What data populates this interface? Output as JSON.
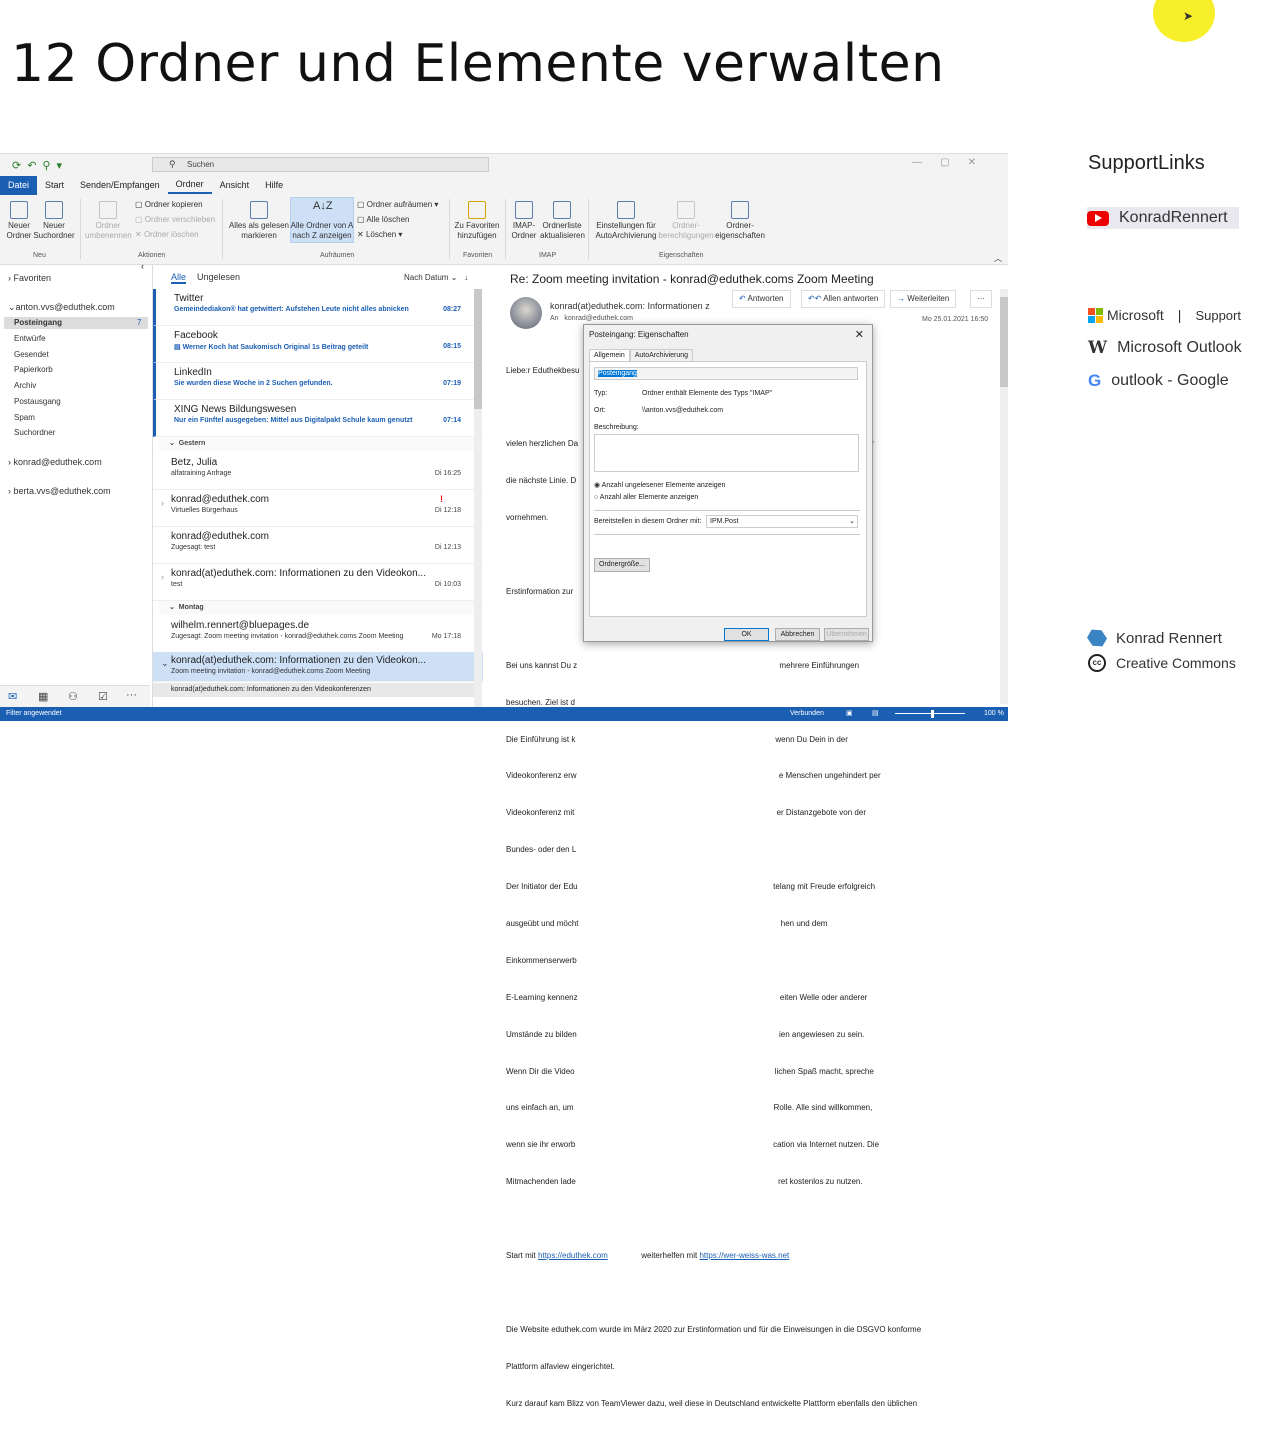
{
  "slide": {
    "title": "12 Ordner und Elemente verwalten"
  },
  "support": {
    "title": "SupportLinks",
    "youtube": "KonradRennert",
    "microsoft": "Microsoft",
    "ms_support": "Support",
    "wiki": "Microsoft Outlook",
    "google": "outlook - Google",
    "author": "Konrad Rennert",
    "license": "Creative Commons"
  },
  "outlook": {
    "search_placeholder": "Suchen",
    "menu": [
      "Datei",
      "Start",
      "Senden/Empfangen",
      "Ordner",
      "Ansicht",
      "Hilfe"
    ],
    "ribbon": {
      "neuer_ordner": "Neuer Ordner",
      "neuer_suchordner": "Neuer Suchordner",
      "ordner_umbenennen": "Ordner umbenennen",
      "ordner_kopieren": "Ordner kopieren",
      "ordner_verschieben": "Ordner verschieben",
      "ordner_loeschen": "Ordner löschen",
      "alles_gelesen": "Alles als gelesen markieren",
      "alle_ordner_az": "Alle Ordner von A nach Z anzeigen",
      "ordner_aufraeumen": "Ordner aufräumen",
      "alle_loeschen": "Alle löschen",
      "loeschen": "Löschen",
      "zu_favoriten": "Zu Favoriten hinzufügen",
      "imap_ordner": "IMAP-Ordner",
      "ordnerliste": "Ordnerliste aktualisieren",
      "einstellungen_auto": "Einstellungen für AutoArchivierung",
      "ordner_berechtigungen": "Ordner-berechtigungen",
      "ordner_eigenschaften": "Ordner-eigenschaften",
      "groups": [
        "Neu",
        "Aktionen",
        "Aufräumen",
        "Favoriten",
        "IMAP",
        "Eigenschaften"
      ]
    },
    "folders": {
      "favoriten": "Favoriten",
      "account1": "anton.vvs@eduthek.com",
      "items": [
        "Posteingang",
        "Entwürfe",
        "Gesendet",
        "Papierkorb",
        "Archiv",
        "Postausgang",
        "Spam",
        "Suchordner"
      ],
      "posteingang_count": "7",
      "account2": "konrad@eduthek.com",
      "account3": "berta.vvs@eduthek.com"
    },
    "list": {
      "tab_all": "Alle",
      "tab_unread": "Ungelesen",
      "sort": "Nach Datum",
      "group_yesterday": "Gestern",
      "group_monday": "Montag",
      "messages": [
        {
          "from": "Twitter",
          "subject": "Gemeindediakon® hat getwittert: Aufstehen Leute nicht alles abnicken",
          "time": "08:27"
        },
        {
          "from": "Facebook",
          "subject": "Werner Koch hat Saukomisch Original 1s Beitrag geteilt",
          "time": "08:15"
        },
        {
          "from": "LinkedIn",
          "subject": "Sie wurden diese Woche in 2 Suchen gefunden.",
          "time": "07:19"
        },
        {
          "from": "XING News Bildungswesen",
          "subject": "Nur ein Fünftel ausgegeben: Mittel aus Digitalpakt Schule kaum genutzt",
          "time": "07:14"
        },
        {
          "from": "Betz, Julia",
          "subject": "alfatraining Anfrage",
          "time": "Di 16:25"
        },
        {
          "from": "konrad@eduthek.com",
          "subject": "Virtuelles Bürgerhaus",
          "time": "Di 12:18"
        },
        {
          "from": "konrad@eduthek.com",
          "subject": "Zugesagt: test",
          "time": "Di 12:13"
        },
        {
          "from": "konrad(at)eduthek.com: Informationen zu den Videokon...",
          "subject": "test",
          "time": "Di 10:03"
        },
        {
          "from": "wilhelm.rennert@bluepages.de",
          "subject": "Zugesagt: Zoom meeting invitation - konrad@eduthek.coms Zoom Meeting",
          "time": "Mo 17:18"
        },
        {
          "from": "konrad(at)eduthek.com: Informationen zu den Videokon...",
          "subject": "Zoom meeting invitation - konrad@eduthek.coms Zoom Meeting",
          "time": ""
        },
        {
          "from": "",
          "subject": "konrad(at)eduthek.com: Informationen zu den Videokonferenzen",
          "time": ""
        }
      ]
    },
    "reading": {
      "subject": "Re:  Zoom meeting invitation - konrad@eduthek.coms Zoom Meeting",
      "sender": "konrad(at)eduthek.com: Informationen z",
      "to_label": "An",
      "to": "konrad@eduthek.com",
      "date": "Mo 25.01.2021 16:50",
      "reply": "Antworten",
      "reply_all": "Allen antworten",
      "forward": "Weiterleiten",
      "more": "···",
      "body": [
        "Liebe:r Eduthekbesu",
        "",
        "vielen herzlichen Da                                                                                           st, blättere weiter bis unter",
        "die nächste Linie. D                                                                                          wir zurzeit Einweisungen",
        "vornehmen.",
        "",
        "Erstinformation zur",
        "",
        "Bei uns kannst Du z                                                                                           mehrere Einführungen",
        "besuchen. Ziel ist d",
        "Die Einführung ist k                                                                                          wenn Du Dein in der",
        "Videokonferenz erw                                                                                           e Menschen ungehindert per",
        "Videokonferenz mit                                                                                           er Distanzgebote von der",
        "Bundes- oder den L",
        "Der Initiator der Edu                                                                                        telang mit Freude erfolgreich",
        "ausgeübt und möcht                                                                                           hen und dem",
        "Einkommenserwerb",
        "E-Learning kennenz                                                                                           eiten Welle oder anderer",
        "Umstände zu bilden                                                                                           ien angewiesen zu sein.",
        "Wenn Dir die Video                                                                                          lichen Spaß macht, spreche",
        "uns einfach an, um                                                                                          Rolle. Alle sind willkommen,",
        "wenn sie ihr erworb                                                                                         cation via Internet nutzen. Die",
        "Mitmachenden lade                                                                                           ret kostenlos zu nutzen."
      ],
      "start_label": "Start mit",
      "start_link": "https://eduthek.com",
      "start_rest": "weiterhelfen mit",
      "start_link2": "https://wer-weiss-was.net",
      "body2": "Die Website eduthek.com wurde im März 2020 zur Erstinformation und für die Einweisungen in die DSGVO konforme",
      "body3": "Plattform alfaview eingerichtet.",
      "body4": "Kurz darauf kam Blizz von TeamViewer dazu, weil diese in Deutschland entwickelte Plattform ebenfalls den üblichen"
    },
    "dialog": {
      "title": "Posteingang: Eigenschaften",
      "tab1": "Allgemein",
      "tab2": "AutoArchivierung",
      "name": "Posteingang",
      "type_label": "Typ:",
      "type_value": "Ordner enthält Elemente des Typs \"IMAP\"",
      "location_label": "Ort:",
      "location_value": "\\\\anton.vvs@eduthek.com",
      "desc_label": "Beschreibung:",
      "radio1": "Anzahl ungelesener Elemente anzeigen",
      "radio2": "Anzahl aller Elemente anzeigen",
      "post_label": "Bereitstellen in diesem Ordner mit:",
      "post_value": "IPM.Post",
      "size_btn": "Ordnergröße...",
      "ok": "OK",
      "cancel": "Abbrechen",
      "apply": "Übernehmen"
    },
    "status": {
      "left": "Filter angewendet",
      "connected": "Verbunden",
      "zoom": "100 %"
    }
  }
}
